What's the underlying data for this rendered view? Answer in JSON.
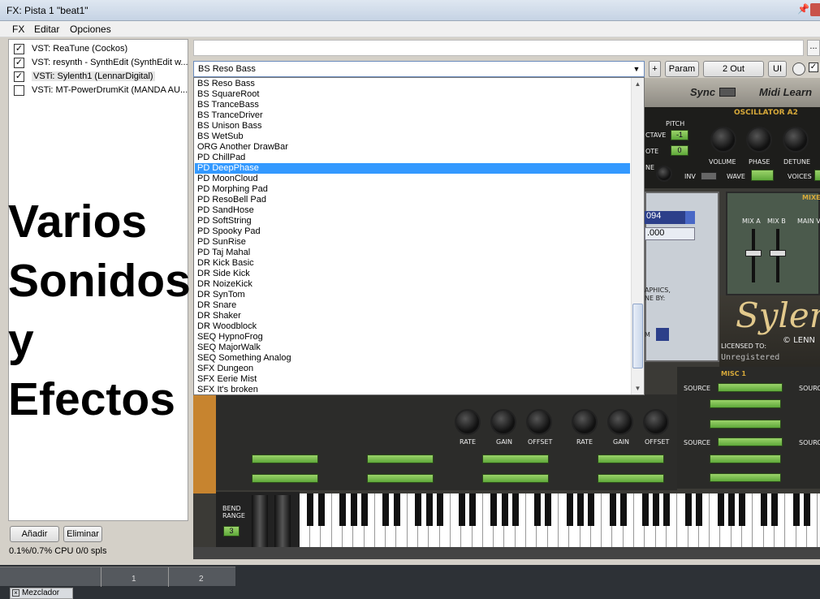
{
  "window": {
    "title": "FX: Pista 1 \"beat1\"",
    "pin_glyph": "📌"
  },
  "menu": {
    "items": [
      "FX",
      "Editar",
      "Opciones"
    ]
  },
  "plugins": [
    {
      "label": "VST: ReaTune (Cockos)",
      "checked": true
    },
    {
      "label": "VST: resynth - SynthEdit (SynthEdit w...",
      "checked": true
    },
    {
      "label": "VSTi: Sylenth1 (LennarDigital)",
      "checked": true,
      "selected": true
    },
    {
      "label": "VSTi: MT-PowerDrumKit (MANDA AU...",
      "checked": false
    }
  ],
  "overlay_text": [
    "Varios",
    "Sonidos",
    "y",
    "Efectos"
  ],
  "buttons": {
    "add": "Añadir",
    "remove": "Eliminar",
    "ellipsis": "...",
    "plus": "+",
    "param": "Param",
    "out": "2 Out",
    "ui": "UI"
  },
  "status": {
    "cpu": "0.1%/0.7% CPU 0/0 spls"
  },
  "preset_select": {
    "value": "BS Reso Bass"
  },
  "preset_list": {
    "highlighted": "PD DeepPhase",
    "items": [
      "BS Reso Bass",
      "BS SquareRoot",
      "BS TranceBass",
      "BS TranceDriver",
      "BS Unison Bass",
      "BS WetSub",
      "ORG Another DrawBar",
      "PD ChillPad",
      "PD DeepPhase",
      "PD MoonCloud",
      "PD Morphing Pad",
      "PD ResoBell Pad",
      "PD SandHose",
      "PD SoftString",
      "PD Spooky Pad",
      "PD SunRise",
      "PD Taj Mahal",
      "DR Kick Basic",
      "DR Side Kick",
      "DR NoizeKick",
      "DR SynTom",
      "DR Snare",
      "DR Shaker",
      "DR Woodblock",
      "SEQ HypnoFrog",
      "SEQ MajorWalk",
      "SEQ Something Analog",
      "SFX Dungeon",
      "SFX Eerie Mist",
      "SFX It's broken"
    ]
  },
  "synth": {
    "sync_label": "Sync",
    "midi_learn_label": "Midi Learn",
    "osc_title": "OSCILLATOR A2",
    "pitch_label": "PITCH",
    "octave_label": "CTAVE",
    "note_label": "OTE",
    "octave_value": "-1",
    "note_value": "0",
    "volume_label": "VOLUME",
    "phase_label": "PHASE",
    "detune_label": "DETUNE",
    "ne_label": "NE",
    "inv_label": "INV",
    "wave_label": "WAVE",
    "voices_label": "VOICES",
    "mixer_label": "MIXE",
    "mix_a_label": "MIX A",
    "mix_b_label": "MIX B",
    "main_v_label": "MAIN V",
    "display_line1": "094",
    "display_line2": ".000",
    "graphics_line1": "APHICS,",
    "graphics_line2": "NE BY:",
    "m_label": "M",
    "logo_text": "Sylen",
    "lenn_text": "© LENN",
    "licensed_to": "LICENSED TO:",
    "unregistered": "Unregistered",
    "misc_label": "MISC 1",
    "source_label": "SOURCE",
    "sourc_label": "SOURC",
    "rate_label": "RATE",
    "gain_label": "GAIN",
    "offset_label": "OFFSET",
    "bend_label": "BEND",
    "range_label": "RANGE",
    "bend_value": "3"
  },
  "timeline": {
    "markers": [
      "1",
      "2"
    ]
  },
  "mixer_tab": {
    "label": "Mezclador"
  }
}
